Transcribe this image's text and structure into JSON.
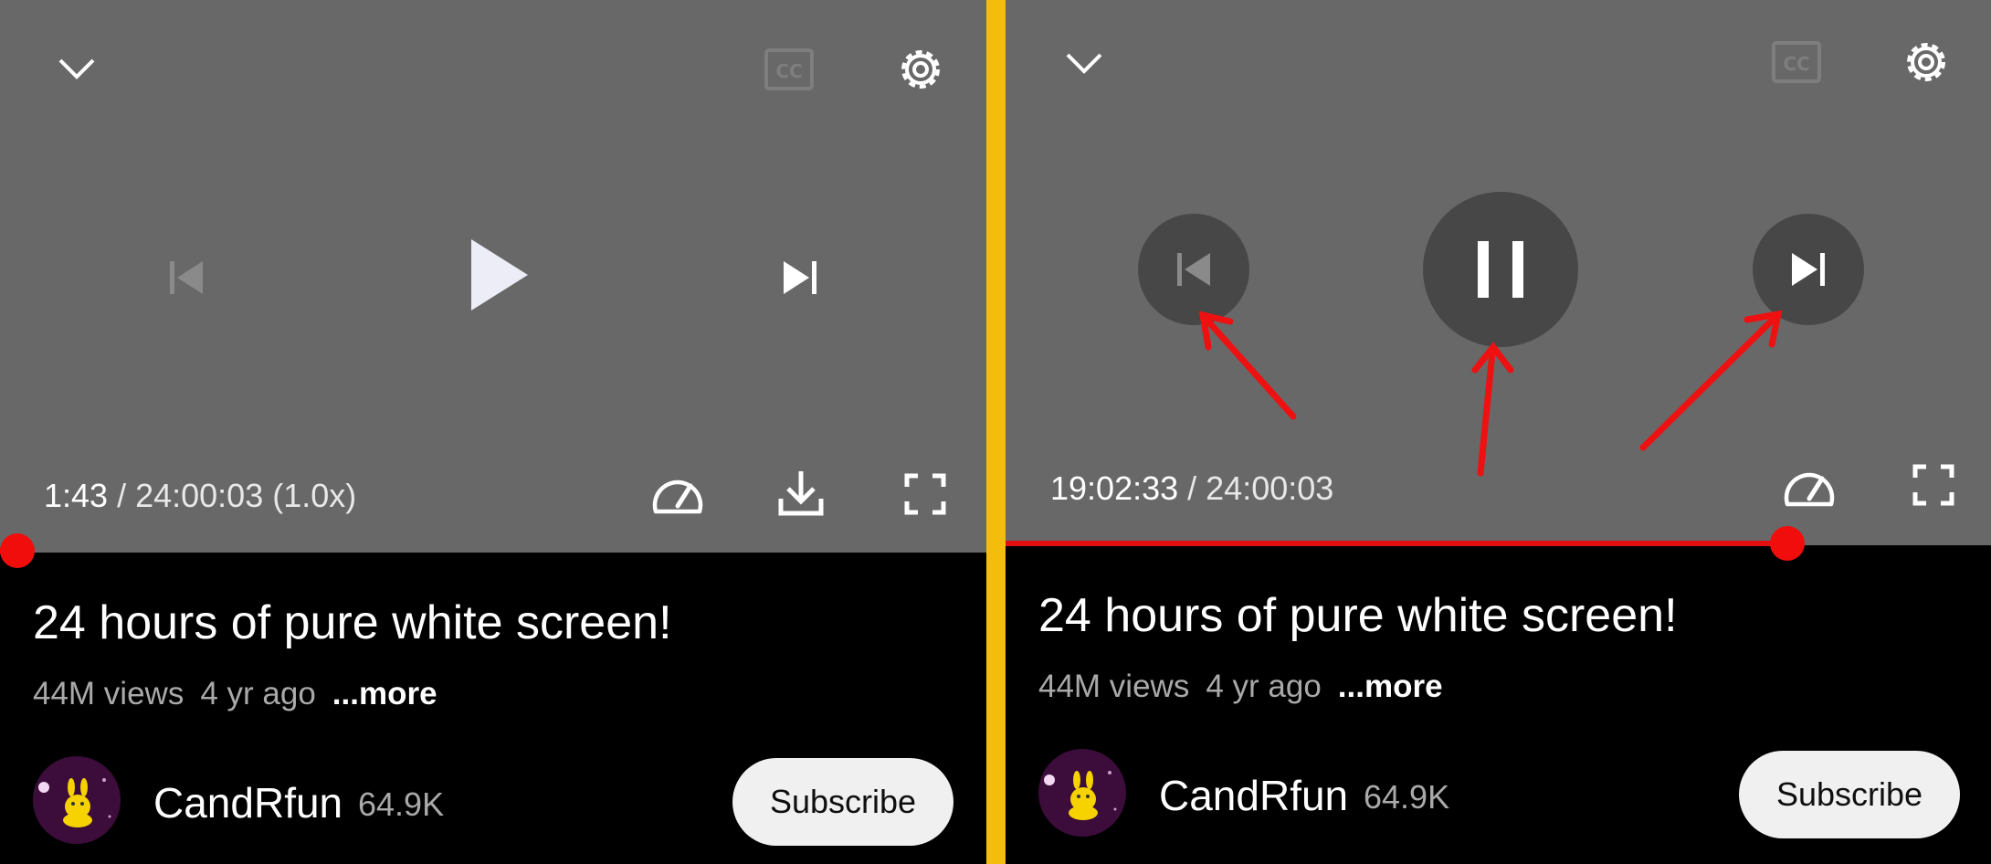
{
  "left": {
    "time_current": "1:43",
    "time_separator": " / ",
    "time_total": "24:00:03 (1.0x)",
    "progress": 0.0012,
    "video_title": "24 hours of pure white screen!",
    "views": "44M views",
    "age": "4 yr ago",
    "more": "...more",
    "channel_name": "CandRfun",
    "subscriber_count": "64.9K",
    "subscribe_label": "Subscribe",
    "controls": [
      "chevron-down-icon",
      "cc-icon",
      "gear-icon",
      "previous-icon",
      "play-icon",
      "next-icon",
      "speed-icon",
      "download-icon",
      "fullscreen-icon"
    ]
  },
  "right": {
    "time_current": "19:02:33",
    "time_separator": " / ",
    "time_total": "24:00:03",
    "progress": 0.793,
    "video_title": "24 hours of pure white screen!",
    "views": "44M views",
    "age": "4 yr ago",
    "more": "...more",
    "channel_name": "CandRfun",
    "subscriber_count": "64.9K",
    "subscribe_label": "Subscribe",
    "controls": [
      "chevron-down-icon",
      "cc-icon",
      "gear-icon",
      "previous-icon",
      "pause-icon",
      "next-icon",
      "speed-icon",
      "fullscreen-icon"
    ]
  },
  "colors": {
    "divider": "#f5bd0b",
    "player_background": "#686868",
    "progress_red": "#e01010",
    "annotation_arrow": "#ee1111",
    "subscribe_background": "#f0f0f0"
  }
}
